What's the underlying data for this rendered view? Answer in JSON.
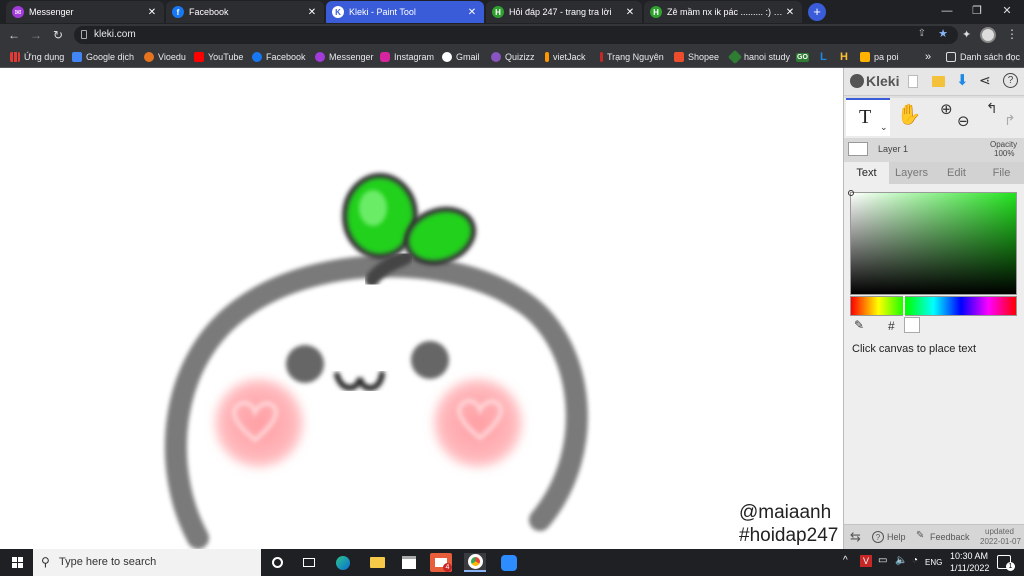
{
  "browser": {
    "tabs": [
      {
        "title": "Messenger",
        "color": "#a33bdb"
      },
      {
        "title": "Facebook",
        "color": "#1877f2"
      },
      {
        "title": "Kleki - Paint Tool",
        "color": "#3b5cd9"
      },
      {
        "title": "Hỏi đáp 247 - trang tra lời",
        "color": "#2fa12f"
      },
      {
        "title": "Zê mầm nx ik pác ......... :) câu hỏi",
        "color": "#2fa12f"
      }
    ],
    "new_tab": "+",
    "url": "kleki.com",
    "bookmarks": [
      {
        "label": "Ứng dụng",
        "color": "#e53935"
      },
      {
        "label": "Google dịch",
        "color": "#4285f4"
      },
      {
        "label": "Vioedu",
        "color": "#e6731e"
      },
      {
        "label": "YouTube",
        "color": "#ff0000"
      },
      {
        "label": "Facebook",
        "color": "#1877f2"
      },
      {
        "label": "Messenger",
        "color": "#a33bdb"
      },
      {
        "label": "Instagram",
        "color": "#d6249f"
      },
      {
        "label": "Gmail",
        "color": "#ffffff"
      },
      {
        "label": "Quizizz",
        "color": "#8854c0"
      },
      {
        "label": "vietJack",
        "color": "#ff9800"
      },
      {
        "label": "Trạng Nguyên",
        "color": "#c62828"
      },
      {
        "label": "Shopee",
        "color": "#ee4d2d"
      },
      {
        "label": "hanoi study",
        "color": "#2e7d32"
      },
      {
        "label": "pa poi",
        "color": "#ffb300"
      }
    ],
    "bookmark_extras": [
      {
        "label": "GO",
        "color": "#2e7d32"
      },
      {
        "label": "L",
        "color": "#1e88e5"
      },
      {
        "label": "H",
        "color": "#fbc02d"
      }
    ],
    "bookmarks_overflow": "»",
    "reading_list": "Danh sách đọc"
  },
  "canvas": {
    "watermark_line1": "@maiaanh",
    "watermark_line2": "#hoidap247"
  },
  "kleki": {
    "logo": "Kleki",
    "layer_name": "Layer 1",
    "opacity_label": "Opacity",
    "opacity_value": "100%",
    "tabs": [
      "Text",
      "Layers",
      "Edit",
      "File"
    ],
    "active_tab": "Text",
    "hex_label": "#",
    "hint": "Click canvas to place text",
    "help": "Help",
    "feedback": "Feedback",
    "updated_label": "updated",
    "updated_date": "2022-01-07",
    "text_tool_glyph": "T",
    "color_accent": "#22e31e"
  },
  "taskbar": {
    "search_placeholder": "Type here to search",
    "lang": "ENG",
    "time": "10:30 AM",
    "date": "1/11/2022",
    "notification_count": "1",
    "badge_count": "4"
  }
}
